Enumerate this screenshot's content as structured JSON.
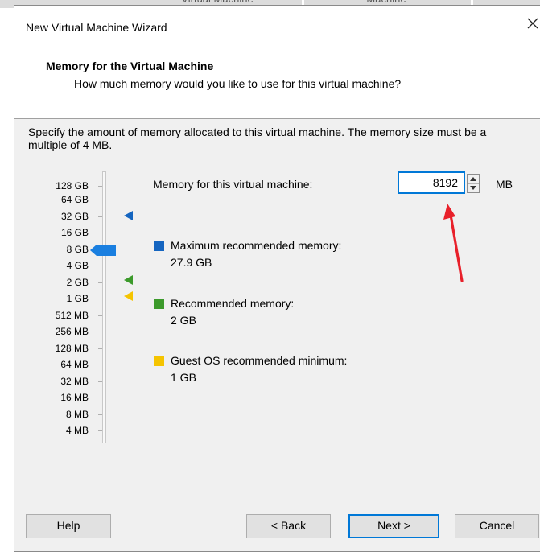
{
  "background": {
    "tab_left": "Virtual Machine",
    "tab_right": "Machine"
  },
  "window": {
    "title": "New Virtual Machine Wizard",
    "close_icon": "close-icon"
  },
  "header": {
    "title": "Memory for the Virtual Machine",
    "subtitle": "How much memory would you like to use for this virtual machine?"
  },
  "instructions": "Specify the amount of memory allocated to this virtual machine. The memory size must be a multiple of 4 MB.",
  "scale": {
    "labels": [
      "128 GB",
      "64 GB",
      "32 GB",
      "16 GB",
      "8 GB",
      "4 GB",
      "2 GB",
      "1 GB",
      "512 MB",
      "256 MB",
      "128 MB",
      "64 MB",
      "32 MB",
      "16 MB",
      "8 MB",
      "4 MB"
    ],
    "selected": "8 GB"
  },
  "memory": {
    "label": "Memory for this virtual machine:",
    "value": "8192",
    "unit": "MB"
  },
  "legend": {
    "max": {
      "label": "Maximum recommended memory:",
      "value": "27.9 GB",
      "color": "#1565c0"
    },
    "recommended": {
      "label": "Recommended memory:",
      "value": "2 GB",
      "color": "#3c9a2b"
    },
    "minimum": {
      "label": "Guest OS recommended minimum:",
      "value": "1 GB",
      "color": "#f5c400"
    }
  },
  "annotation": {
    "arrow_color": "#e8202a"
  },
  "buttons": {
    "help": "Help",
    "back": "< Back",
    "next": "Next >",
    "cancel": "Cancel"
  }
}
